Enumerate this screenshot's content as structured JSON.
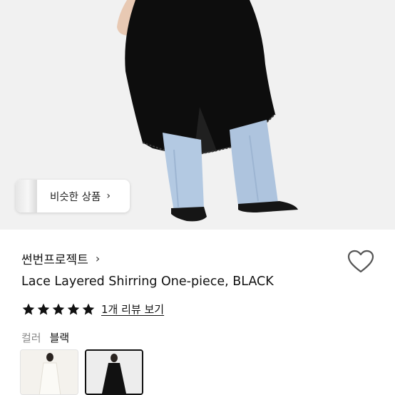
{
  "similar_products": {
    "label": "비슷한 상품",
    "chevron": "›"
  },
  "brand": {
    "name": "썬번프로젝트",
    "chevron": "›"
  },
  "product": {
    "title": "Lace Layered Shirring One-piece, BLACK"
  },
  "rating": {
    "stars": 5,
    "max": 5,
    "review_link": "1개 리뷰 보기"
  },
  "color": {
    "label": "컬러",
    "value": "블랙"
  },
  "swatches": [
    {
      "name": "ivory",
      "selected": false
    },
    {
      "name": "black",
      "selected": true
    }
  ],
  "icons": {
    "wishlist": "heart-outline-icon",
    "star": "star-filled-icon"
  },
  "colors": {
    "text": "#111111",
    "muted": "#888888",
    "hero_bg": "#f1f1f1"
  }
}
